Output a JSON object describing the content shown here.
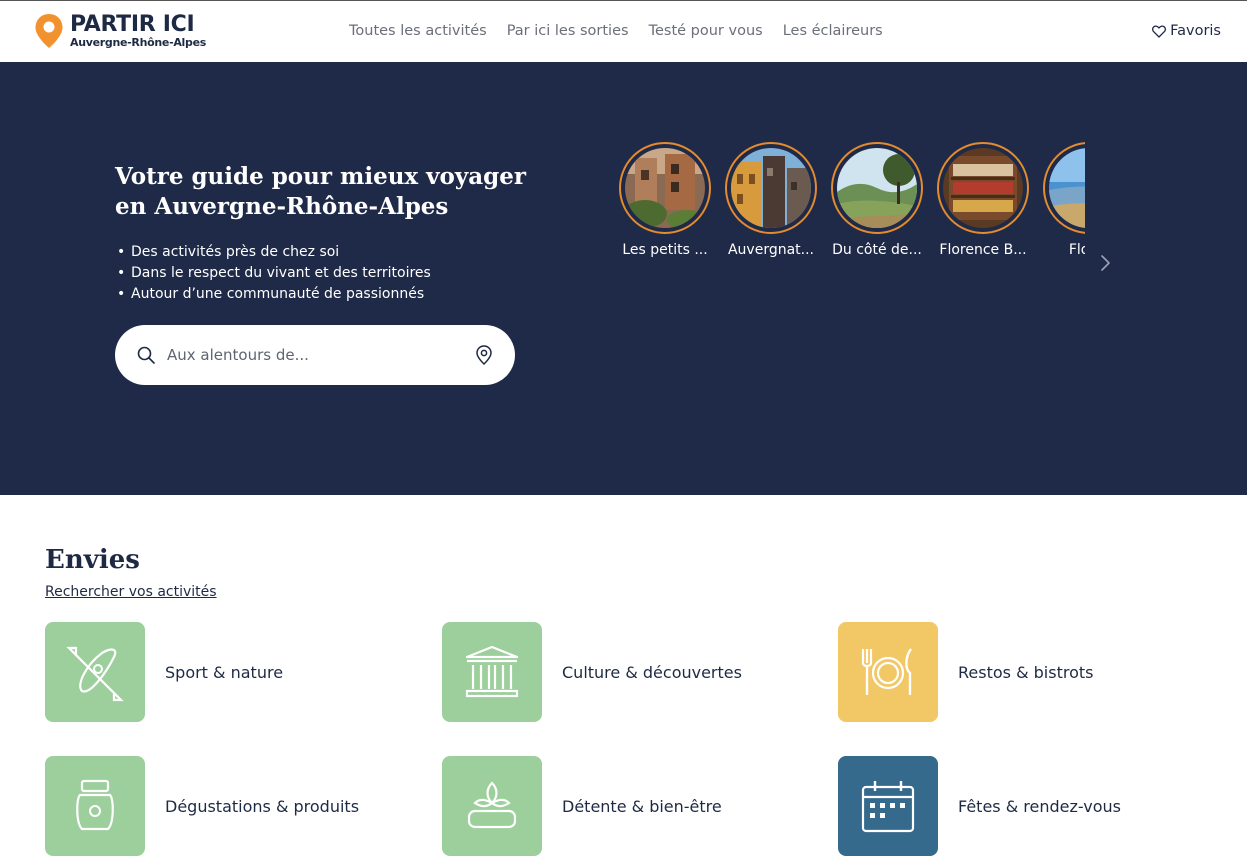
{
  "brand": {
    "title": "PARTIR ICI",
    "subtitle": "Auvergne-Rhône-Alpes",
    "accent": "#f2922e",
    "navy": "#1f2a48"
  },
  "nav": [
    {
      "label": "Toutes les activités"
    },
    {
      "label": "Par ici les sorties"
    },
    {
      "label": "Testé pour vous"
    },
    {
      "label": "Les éclaireurs"
    }
  ],
  "favorites": {
    "label": "Favoris",
    "icon": "heart-icon"
  },
  "hero": {
    "title": "Votre guide pour mieux voyager en Auvergne-Rhône-Alpes",
    "bullets": [
      "Des activités près de chez soi",
      "Dans le respect du vivant et des territoires",
      "Autour d’une communauté de passionnés"
    ],
    "search": {
      "placeholder": "Aux alentours de...",
      "icon": "search-icon",
      "location_icon": "location-pin-icon"
    }
  },
  "stories": [
    {
      "label": "Les petits ..."
    },
    {
      "label": "Auvergnat..."
    },
    {
      "label": "Du côté de..."
    },
    {
      "label": "Florence B..."
    },
    {
      "label": "Florer"
    }
  ],
  "envies": {
    "title": "Envies",
    "link": "Rechercher vos activités",
    "categories": [
      {
        "label": "Sport & nature",
        "icon": "kayak-icon",
        "color": "#9ccf9c"
      },
      {
        "label": "Culture & découvertes",
        "icon": "museum-icon",
        "color": "#9ccf9c"
      },
      {
        "label": "Restos & bistrots",
        "icon": "cutlery-icon",
        "color": "#f2c766"
      },
      {
        "label": "Dégustations & produits",
        "icon": "jar-icon",
        "color": "#9ccf9c"
      },
      {
        "label": "Détente & bien-être",
        "icon": "lotus-icon",
        "color": "#9ccf9c"
      },
      {
        "label": "Fêtes & rendez-vous",
        "icon": "calendar-icon",
        "color": "#356a8c"
      }
    ]
  }
}
